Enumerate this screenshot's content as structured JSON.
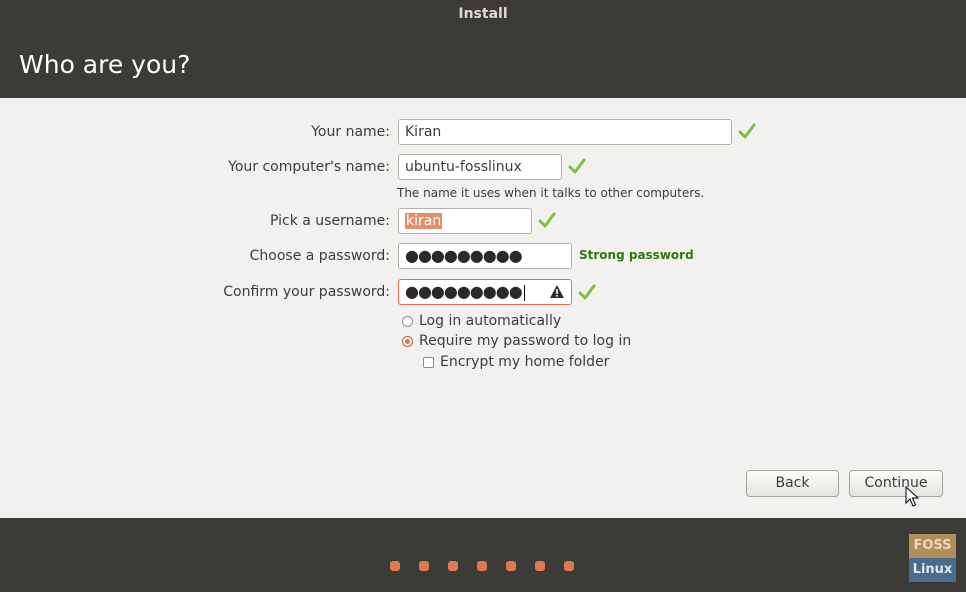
{
  "window": {
    "title": "Install"
  },
  "header": {
    "title": "Who are you?"
  },
  "form": {
    "name": {
      "label": "Your name:",
      "value": "Kiran"
    },
    "computer": {
      "label": "Your computer's name:",
      "value": "ubuntu-fosslinux",
      "hint": "The name it uses when it talks to other computers."
    },
    "username": {
      "label": "Pick a username:",
      "value": "kiran"
    },
    "password": {
      "label": "Choose a password:",
      "value": "●●●●●●●●●",
      "strength": "Strong password"
    },
    "confirm": {
      "label": "Confirm your password:",
      "value": "●●●●●●●●●"
    },
    "login_options": [
      {
        "label": "Log in automatically",
        "selected": false
      },
      {
        "label": "Require my password to log in",
        "selected": true
      }
    ],
    "encrypt": {
      "label": "Encrypt my home folder",
      "checked": false
    }
  },
  "buttons": {
    "back": "Back",
    "continue": "Continue"
  },
  "progress": {
    "steps": 7
  },
  "watermark": {
    "line1": "FOSS",
    "line2": "Linux"
  },
  "colors": {
    "accent": "#e96f45",
    "dark": "#3c3b37",
    "ok": "#7dc142",
    "strong": "#2b7a0b"
  }
}
